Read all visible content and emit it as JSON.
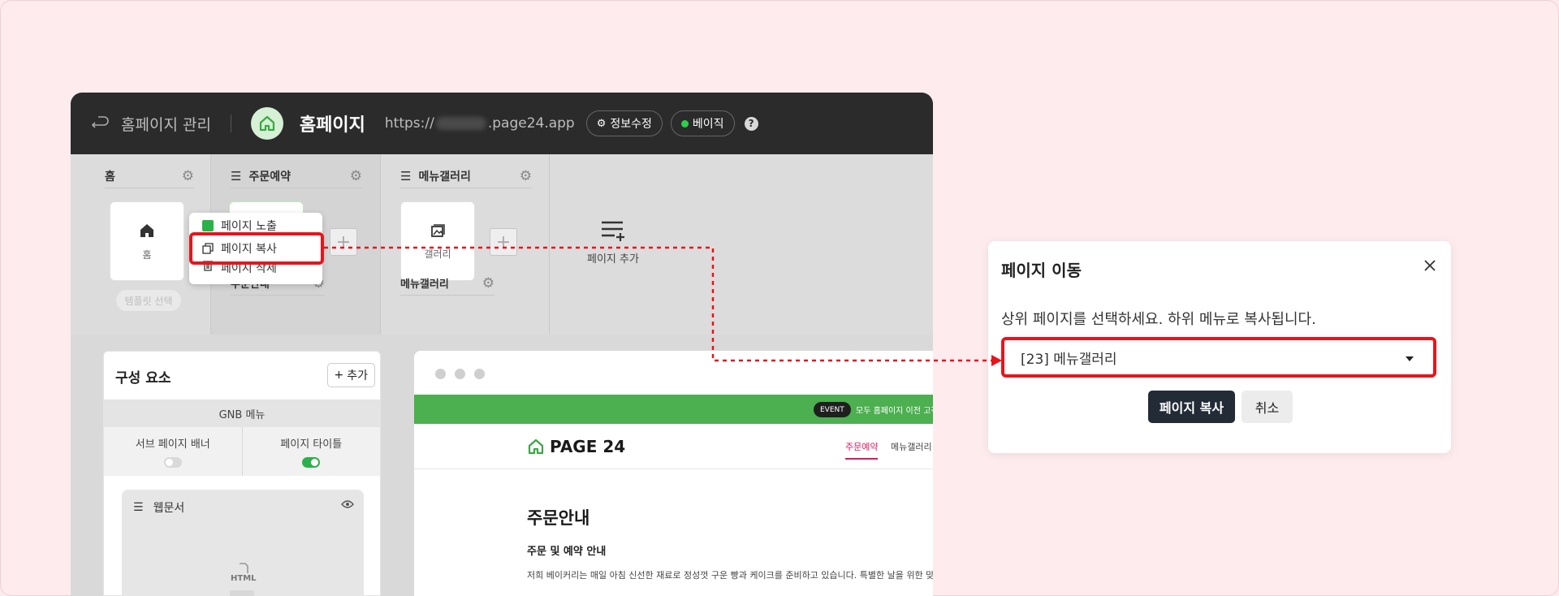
{
  "topbar": {
    "manage_label": "홈페이지 관리",
    "site_title": "홈페이지",
    "url_prefix": "https://",
    "url_suffix": ".page24.app",
    "edit_info_label": "정보수정",
    "plan_label": "베이직",
    "help_label": "?"
  },
  "tree": {
    "home": {
      "title": "홈",
      "card_label": "홈",
      "template_label": "템플릿 선택"
    },
    "order": {
      "title": "주문예약",
      "sub_title": "주문안내"
    },
    "gallery": {
      "title": "메뉴갤러리",
      "card_label": "갤러리",
      "sub_title": "메뉴갤러리"
    },
    "add_page_label": "페이지 추가"
  },
  "context_menu": {
    "items": [
      "페이지 노출",
      "페이지 복사",
      "페이지 삭제"
    ]
  },
  "components": {
    "title": "구성 요소",
    "add_label": "추가",
    "gnb_label": "GNB 메뉴",
    "sub_banner_label": "서브 페이지 배너",
    "page_title_label": "페이지 타이틀",
    "sub_banner_on": false,
    "page_title_on": true,
    "webdoc_label": "웹문서",
    "html_label": "HTML"
  },
  "preview": {
    "event_label": "EVENT",
    "banner_text": "모두 홈페이지 이전 고객",
    "logo_text": "PAGE 24",
    "nav": [
      "주문예약",
      "메뉴갤러리"
    ],
    "heading": "주문안내",
    "subheading": "주문 및 예약 안내",
    "paragraph": "저희 베이커리는 매일 아침 신선한 재료로 정성껏 구운 빵과 케이크를 준비하고 있습니다. 특별한 날을 위한 맞춤 케"
  },
  "dialog": {
    "title": "페이지 이동",
    "description": "상위 페이지를 선택하세요. 하위 메뉴로 복사됩니다.",
    "selected_value": "[23] 메뉴갤러리",
    "copy_label": "페이지 복사",
    "cancel_label": "취소"
  },
  "colors": {
    "highlight": "#e8141b",
    "brand_green": "#4caf50",
    "topbar_bg": "#2b2b2b",
    "accent_pink": "#d81b60"
  }
}
